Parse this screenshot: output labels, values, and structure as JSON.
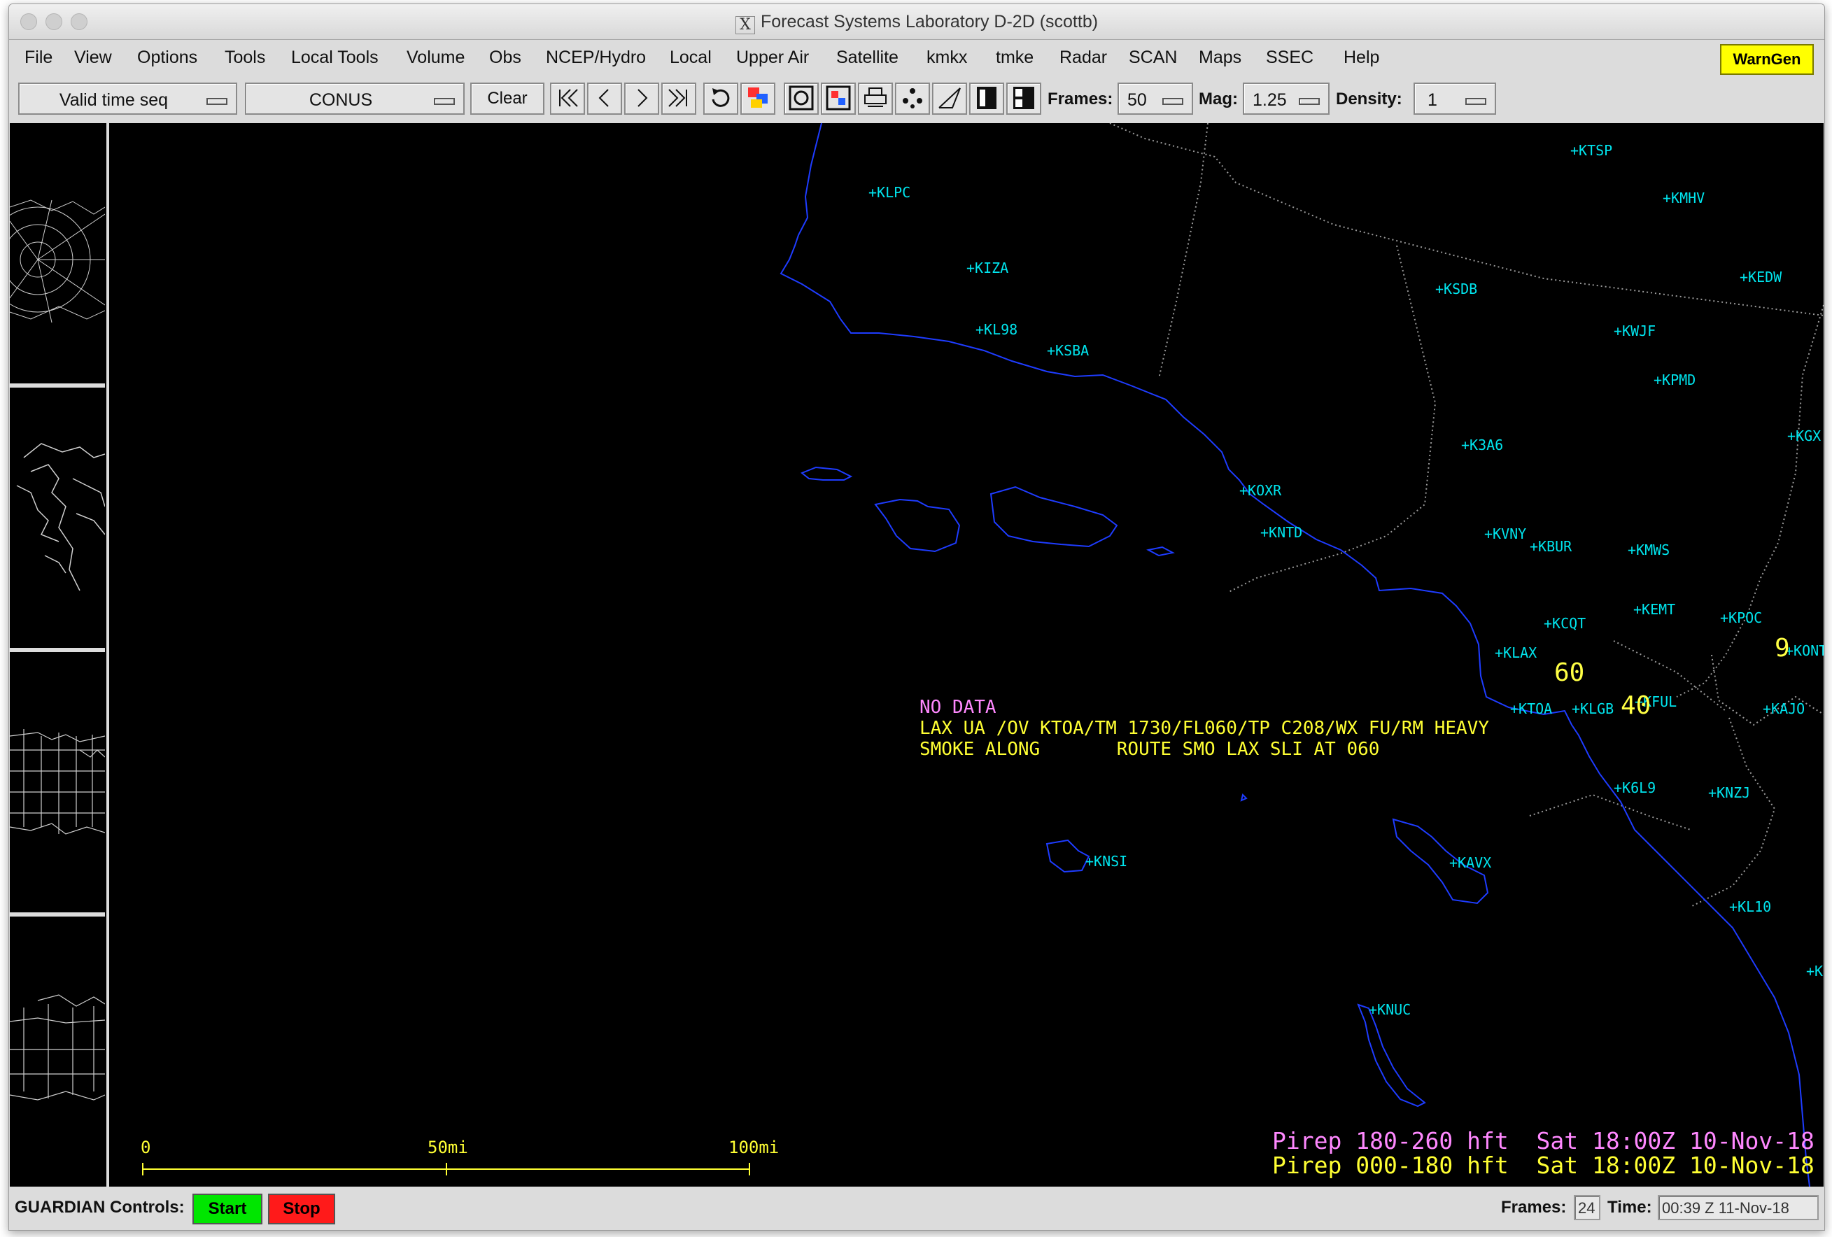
{
  "window": {
    "title": "Forecast Systems Laboratory D-2D (scottb)",
    "x_logo": "X"
  },
  "menubar": {
    "items": [
      "File",
      "View",
      "Options",
      "Tools",
      "Local Tools",
      "Volume",
      "Obs",
      "NCEP/Hydro",
      "Local",
      "Upper Air",
      "Satellite",
      "kmkx",
      "tmke",
      "Radar",
      "SCAN",
      "Maps",
      "SSEC",
      "Help"
    ],
    "warngen": "WarnGen"
  },
  "toolbar": {
    "time_mode": "Valid time seq",
    "scale": "CONUS",
    "clear": "Clear",
    "frames_label": "Frames:",
    "frames_value": "50",
    "mag_label": "Mag:",
    "mag_value": "1.25",
    "density_label": "Density:",
    "density_value": "1"
  },
  "map": {
    "stations": [
      {
        "id": "KTSP"
      },
      {
        "id": "KMHV"
      },
      {
        "id": "KLPC"
      },
      {
        "id": "KIZA"
      },
      {
        "id": "KEDW"
      },
      {
        "id": "KSDB"
      },
      {
        "id": "KWJF"
      },
      {
        "id": "KL98"
      },
      {
        "id": "KSBA"
      },
      {
        "id": "KPMD"
      },
      {
        "id": "KGX"
      },
      {
        "id": "K3A6"
      },
      {
        "id": "KOXR"
      },
      {
        "id": "KNTD"
      },
      {
        "id": "KVNY"
      },
      {
        "id": "KBUR"
      },
      {
        "id": "KMWS"
      },
      {
        "id": "KEMT"
      },
      {
        "id": "KPOC"
      },
      {
        "id": "KCQT"
      },
      {
        "id": "KLAX"
      },
      {
        "id": "KONT"
      },
      {
        "id": "KTOA"
      },
      {
        "id": "KLGB"
      },
      {
        "id": "KFUL"
      },
      {
        "id": "KAJO"
      },
      {
        "id": "K6L9"
      },
      {
        "id": "KNZJ"
      },
      {
        "id": "KNSI"
      },
      {
        "id": "KAVX"
      },
      {
        "id": "KL10"
      },
      {
        "id": "KNUC"
      },
      {
        "id": "K"
      }
    ],
    "plot_values": [
      "60",
      "40",
      "9"
    ],
    "no_data": "NO DATA",
    "pirep_line1": "LAX UA /OV KTOA/TM 1730/FL060/TP C208/WX FU/RM HEAVY",
    "pirep_line2": "SMOKE ALONG       ROUTE SMO LAX SLI AT 060",
    "scale_labels": [
      "0",
      "50mi",
      "100mi"
    ],
    "legend": [
      {
        "text": "Pirep 180-260 hft  Sat 18:00Z 10-Nov-18",
        "color": "#ff88ff"
      },
      {
        "text": "Pirep 000-180 hft  Sat 18:00Z 10-Nov-18",
        "color": "#ffff33"
      }
    ]
  },
  "status": {
    "guardian_label": "GUARDIAN Controls:",
    "start": "Start",
    "stop": "Stop",
    "frames_label": "Frames:",
    "frames_value": "24",
    "time_label": "Time:",
    "time_value": "00:39 Z 11-Nov-18"
  },
  "colors": {
    "coast": "#1e3cff",
    "station": "#00e5ee",
    "pirep": "#ffff33",
    "warngen": "#ffff00",
    "start": "#00e600",
    "stop": "#ff1a1a"
  }
}
